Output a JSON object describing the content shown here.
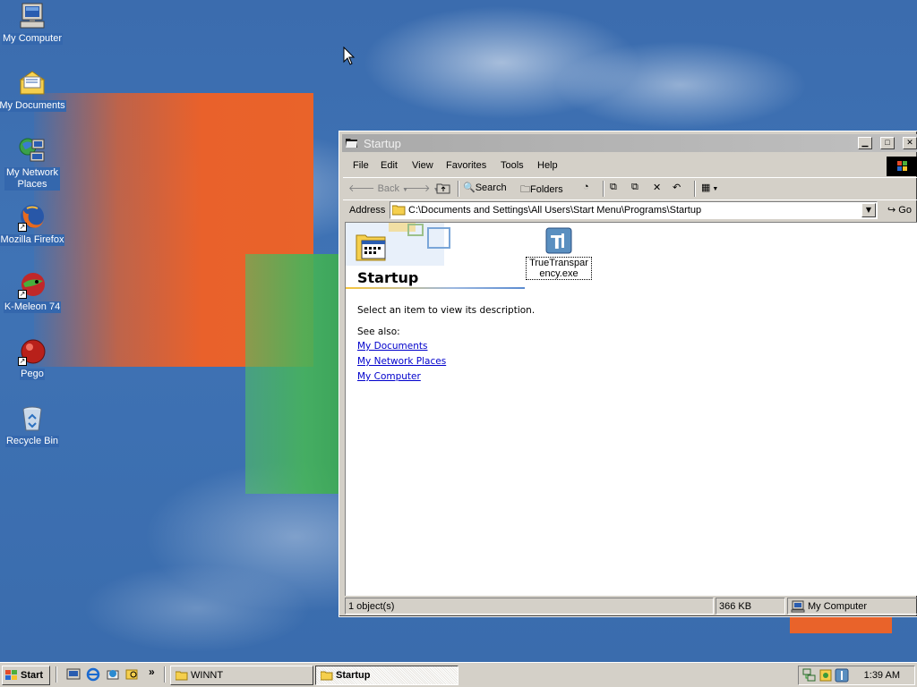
{
  "desktop": {
    "icons": [
      {
        "label": "My Computer",
        "icon": "computer-icon"
      },
      {
        "label": "My Documents",
        "icon": "folder-documents-icon"
      },
      {
        "label": "My Network Places",
        "icon": "network-icon"
      },
      {
        "label": "Mozilla Firefox",
        "icon": "firefox-icon"
      },
      {
        "label": "K-Meleon 74",
        "icon": "kmeleon-icon"
      },
      {
        "label": "Pego",
        "icon": "pego-icon"
      },
      {
        "label": "Recycle Bin",
        "icon": "recycle-bin-icon"
      }
    ]
  },
  "window": {
    "title": "Startup",
    "menu": [
      "File",
      "Edit",
      "View",
      "Favorites",
      "Tools",
      "Help"
    ],
    "toolbar": {
      "back": "Back",
      "search": "Search",
      "folders": "Folders"
    },
    "address": {
      "label": "Address",
      "value": "C:\\Documents and Settings\\All Users\\Start Menu\\Programs\\Startup",
      "go": "Go"
    },
    "webview": {
      "title": "Startup",
      "description": "Select an item to view its description.",
      "see_also": "See also:",
      "links": [
        "My Documents",
        "My Network Places",
        "My Computer"
      ]
    },
    "files": [
      {
        "name": "TrueTransparency.exe",
        "icon": "truetransparency-icon"
      }
    ],
    "status": {
      "objects": "1 object(s)",
      "size": "366 KB",
      "zone": "My Computer"
    }
  },
  "taskbar": {
    "start": "Start",
    "tasks": [
      {
        "label": "WINNT",
        "active": false
      },
      {
        "label": "Startup",
        "active": true
      }
    ],
    "quicklaunch_more": "»",
    "clock": "1:39 AM"
  },
  "colors": {
    "desktop": "#3b6cae",
    "inactive_title": "#a9a9a9",
    "link": "#0000cc",
    "face": "#d4d0c8"
  }
}
